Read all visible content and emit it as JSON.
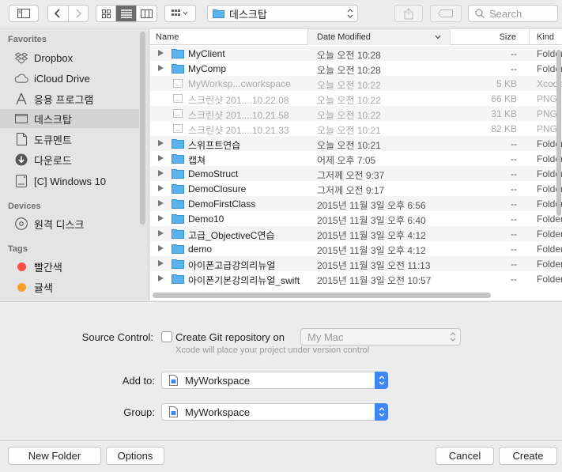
{
  "toolbar": {
    "location_label": "데스크탑",
    "search_placeholder": "Search"
  },
  "sidebar": {
    "favorites_title": "Favorites",
    "favorites": [
      {
        "label": "Dropbox",
        "icon": "dropbox-icon"
      },
      {
        "label": "iCloud Drive",
        "icon": "cloud-icon"
      },
      {
        "label": "응용 프로그램",
        "icon": "applications-icon"
      },
      {
        "label": "데스크탑",
        "icon": "desktop-icon",
        "selected": true
      },
      {
        "label": "도큐멘트",
        "icon": "document-icon"
      },
      {
        "label": "다운로드",
        "icon": "download-icon"
      },
      {
        "label": "[C] Windows 10",
        "icon": "drive-icon"
      }
    ],
    "devices_title": "Devices",
    "devices": [
      {
        "label": "원격 디스크",
        "icon": "remote-disc-icon"
      }
    ],
    "tags_title": "Tags",
    "tags": [
      {
        "label": "빨간색",
        "color": "#fb4f47"
      },
      {
        "label": "귤색",
        "color": "#f9a02d"
      }
    ]
  },
  "filelist": {
    "columns": {
      "name": "Name",
      "date": "Date Modified",
      "size": "Size",
      "kind": "Kind"
    },
    "rows": [
      {
        "name": "MyClient",
        "date": "오늘 오전 10:28",
        "size": "--",
        "kind": "Folder",
        "type": "folder",
        "disclosure": true
      },
      {
        "name": "MyComp",
        "date": "오늘 오전 10:28",
        "size": "--",
        "kind": "Folder",
        "type": "folder",
        "disclosure": true
      },
      {
        "name": "MyWorksp...cworkspace",
        "date": "오늘 오전 10:22",
        "size": "5 KB",
        "kind": "Xcode",
        "type": "file",
        "disclosure": false,
        "dim": true
      },
      {
        "name": "스크린샷 201....10.22.08",
        "date": "오늘 오전 10:22",
        "size": "66 KB",
        "kind": "PNG",
        "type": "file",
        "disclosure": false,
        "dim": true
      },
      {
        "name": "스크린샷 201....10.21.58",
        "date": "오늘 오전 10:22",
        "size": "31 KB",
        "kind": "PNG",
        "type": "file",
        "disclosure": false,
        "dim": true
      },
      {
        "name": "스크린샷 201....10.21.33",
        "date": "오늘 오전 10:21",
        "size": "82 KB",
        "kind": "PNG",
        "type": "file",
        "disclosure": false,
        "dim": true
      },
      {
        "name": "스위프트연습",
        "date": "오늘 오전 10:21",
        "size": "--",
        "kind": "Folder",
        "type": "folder",
        "disclosure": true
      },
      {
        "name": "캡쳐",
        "date": "어제 오후 7:05",
        "size": "--",
        "kind": "Folder",
        "type": "folder",
        "disclosure": true
      },
      {
        "name": "DemoStruct",
        "date": "그저께 오전 9:37",
        "size": "--",
        "kind": "Folder",
        "type": "folder",
        "disclosure": true
      },
      {
        "name": "DemoClosure",
        "date": "그저께 오전 9:17",
        "size": "--",
        "kind": "Folder",
        "type": "folder",
        "disclosure": true
      },
      {
        "name": "DemoFirstClass",
        "date": "2015년 11월 3일 오후 6:56",
        "size": "--",
        "kind": "Folder",
        "type": "folder",
        "disclosure": true
      },
      {
        "name": "Demo10",
        "date": "2015년 11월 3일 오후 6:40",
        "size": "--",
        "kind": "Folder",
        "type": "folder",
        "disclosure": true
      },
      {
        "name": "고급_ObjectiveC연습",
        "date": "2015년 11월 3일 오후 4:12",
        "size": "--",
        "kind": "Folder",
        "type": "folder",
        "disclosure": true
      },
      {
        "name": "demo",
        "date": "2015년 11월 3일 오후 4:12",
        "size": "--",
        "kind": "Folder",
        "type": "folder",
        "disclosure": true
      },
      {
        "name": "아이폰고급강의리뉴얼",
        "date": "2015년 11월 3일 오전 11:13",
        "size": "--",
        "kind": "Folder",
        "type": "folder",
        "disclosure": true
      },
      {
        "name": "아이폰기본강의리뉴얼_swift",
        "date": "2015년 11월 3일 오전 10:57",
        "size": "--",
        "kind": "Folder",
        "type": "folder",
        "disclosure": true
      }
    ]
  },
  "options": {
    "source_control_label": "Source Control:",
    "create_git_label": "Create Git repository on",
    "git_location_value": "My Mac",
    "git_hint": "Xcode will place your project under version control",
    "add_to_label": "Add to:",
    "add_to_value": "MyWorkspace",
    "group_label": "Group:",
    "group_value": "MyWorkspace"
  },
  "buttons": {
    "new_folder": "New Folder",
    "options": "Options",
    "cancel": "Cancel",
    "create": "Create"
  },
  "colors": {
    "folder": "#5ab2ef",
    "accent": "#3f87f5"
  }
}
